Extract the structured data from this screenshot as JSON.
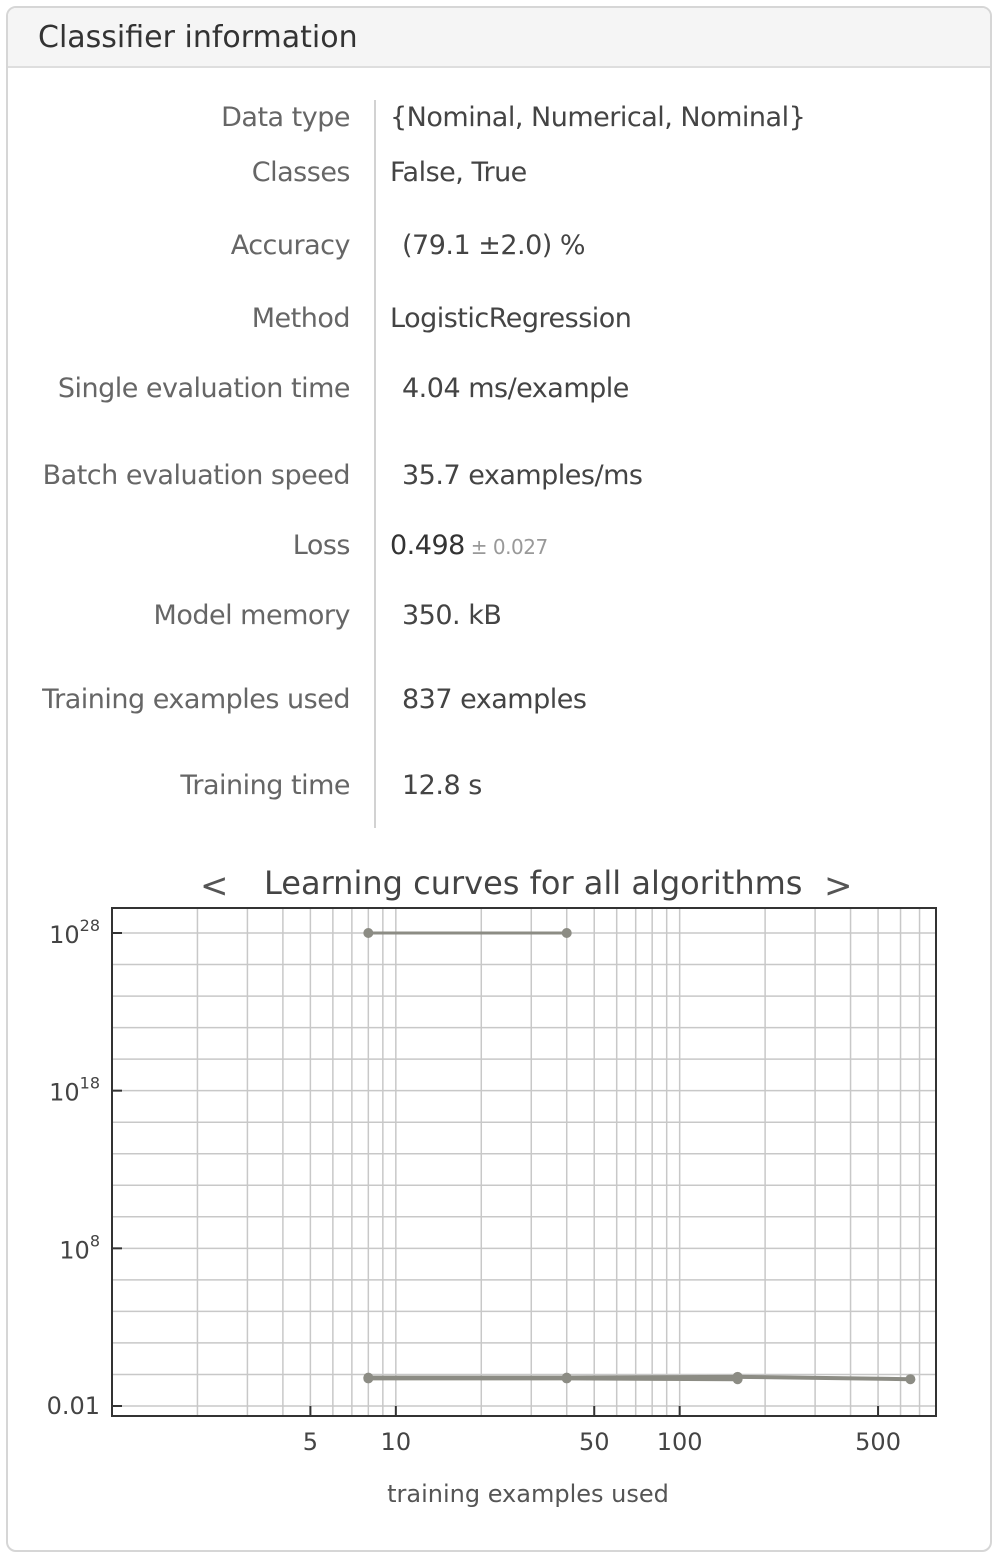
{
  "panel": {
    "title": "Classifier information"
  },
  "info": [
    {
      "label": "Data type",
      "value": "{Nominal, Numerical, Nominal}"
    },
    {
      "label": "Classes",
      "value": "False, True"
    },
    {
      "label": "Accuracy",
      "value": "(79.1 ±2.0) %"
    },
    {
      "label": "Method",
      "value": "LogisticRegression"
    },
    {
      "label": "Single evaluation time",
      "value": "4.04 ms/example"
    },
    {
      "label": "Batch evaluation speed",
      "value": "35.7 examples/ms"
    },
    {
      "label": "Loss",
      "value": "0.498",
      "error": "± 0.027"
    },
    {
      "label": "Model memory",
      "value": "350. kB"
    },
    {
      "label": "Training examples used",
      "value": "837 examples"
    },
    {
      "label": "Training time",
      "value": "12.8 s"
    }
  ],
  "chart_nav": {
    "prev": "<",
    "next": ">"
  },
  "icons": {
    "prev": "chevron-left-icon",
    "next": "chevron-right-icon"
  },
  "colors": {
    "series": "#8c8c84",
    "grid": "#c8c8c8",
    "frame": "#333333"
  },
  "chart_data": {
    "type": "line",
    "title": "Learning curves for all algorithms",
    "xlabel": "training examples used",
    "ylabel": "",
    "xscale": "log",
    "yscale": "log",
    "xlim": [
      1,
      800
    ],
    "x_ticks": [
      {
        "value": 5,
        "label": "5"
      },
      {
        "value": 10,
        "label": "10"
      },
      {
        "value": 50,
        "label": "50"
      },
      {
        "value": 100,
        "label": "100"
      },
      {
        "value": 500,
        "label": "500"
      }
    ],
    "y_ticks": [
      {
        "exponent": -2,
        "base": "",
        "sup": "",
        "label": "0.01"
      },
      {
        "exponent": 8,
        "base": "10",
        "sup": "8",
        "label": ""
      },
      {
        "exponent": 18,
        "base": "10",
        "sup": "18",
        "label": ""
      },
      {
        "exponent": 28,
        "base": "10",
        "sup": "28",
        "label": ""
      }
    ],
    "grid": true,
    "series": [
      {
        "x": [
          8,
          40
        ],
        "y_log10": [
          28,
          28
        ]
      },
      {
        "x": [
          8,
          40,
          160,
          650
        ],
        "y_log10": [
          -0.2,
          -0.2,
          -0.15,
          -0.3
        ]
      },
      {
        "x": [
          8,
          40,
          160
        ],
        "y_log10": [
          -0.25,
          -0.25,
          -0.3
        ]
      }
    ]
  }
}
